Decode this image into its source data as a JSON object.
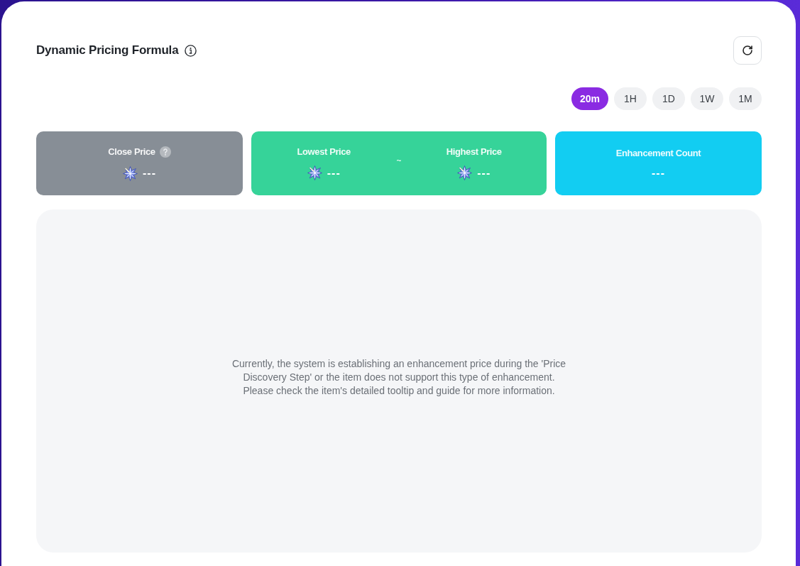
{
  "header": {
    "title": "Dynamic Pricing Formula"
  },
  "intervals": [
    {
      "label": "20m",
      "selected": true
    },
    {
      "label": "1H",
      "selected": false
    },
    {
      "label": "1D",
      "selected": false
    },
    {
      "label": "1W",
      "selected": false
    },
    {
      "label": "1M",
      "selected": false
    }
  ],
  "stats": [
    {
      "kind": "single",
      "color": "#878e96",
      "label": "Close Price",
      "help": true,
      "value": "---"
    },
    {
      "kind": "range",
      "color": "#36d399",
      "low": {
        "label": "Lowest Price",
        "value": "---"
      },
      "separator": "~",
      "high": {
        "label": "Highest Price",
        "value": "---"
      }
    },
    {
      "kind": "count",
      "color": "#12cdf2",
      "label": "Enhancement Count",
      "value": "---"
    }
  ],
  "empty_state": {
    "message": "Currently, the system is establishing an enhancement price during the 'Price Discovery Step' or the item does not support this type of enhancement. Please check the item's detailed tooltip and guide for more information."
  }
}
